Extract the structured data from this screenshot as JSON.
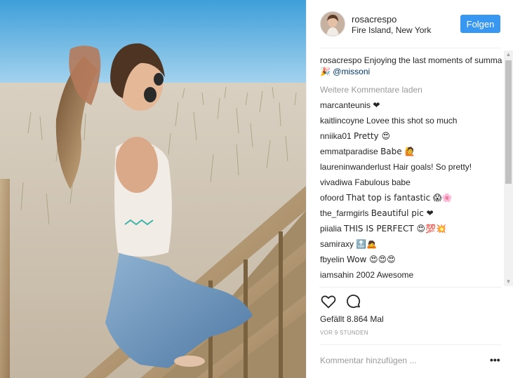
{
  "post": {
    "username": "rosacrespo",
    "location": "Fire Island, New York",
    "follow_label": "Folgen",
    "caption_user": "rosacrespo",
    "caption_text": "Enjoying the last moments of summa 🎉",
    "caption_mention": "@missoni",
    "load_more": "Weitere Kommentare laden",
    "likes": "Gefällt 8.864 Mal",
    "timestamp": "VOR 9 STUNDEN",
    "comment_placeholder": "Kommentar hinzufügen ...",
    "more_label": "•••"
  },
  "comments": [
    {
      "user": "marcanteunis",
      "text": "❤"
    },
    {
      "user": "kaitlincoyne",
      "text": "Lovee this shot so much"
    },
    {
      "user": "nniika01",
      "text": "Pretty 😍"
    },
    {
      "user": "emmatparadise",
      "text": "Babe 🙋"
    },
    {
      "user": "laureninwanderlust",
      "text": "Hair goals! So pretty!"
    },
    {
      "user": "vivadiwa",
      "text": "Fabulous babe"
    },
    {
      "user": "ofoord",
      "text": "That top is fantastic 😱🌸"
    },
    {
      "user": "the_farmgirls",
      "text": "Beautiful pic ❤"
    },
    {
      "user": "piialia",
      "text": "THIS IS PERFECT 😍💯💥"
    },
    {
      "user": "samiraxy",
      "text": "🔝🙇"
    },
    {
      "user": "fbyelin",
      "text": "Wow 😍😍😍"
    },
    {
      "user": "iamsahin",
      "text": "2002 Awesome"
    }
  ],
  "icons": {
    "like": "heart-icon",
    "comment": "comment-bubble-icon",
    "more": "more-options-icon"
  },
  "colors": {
    "follow_bg": "#3897f0",
    "mention": "#003569",
    "muted": "#999999"
  }
}
